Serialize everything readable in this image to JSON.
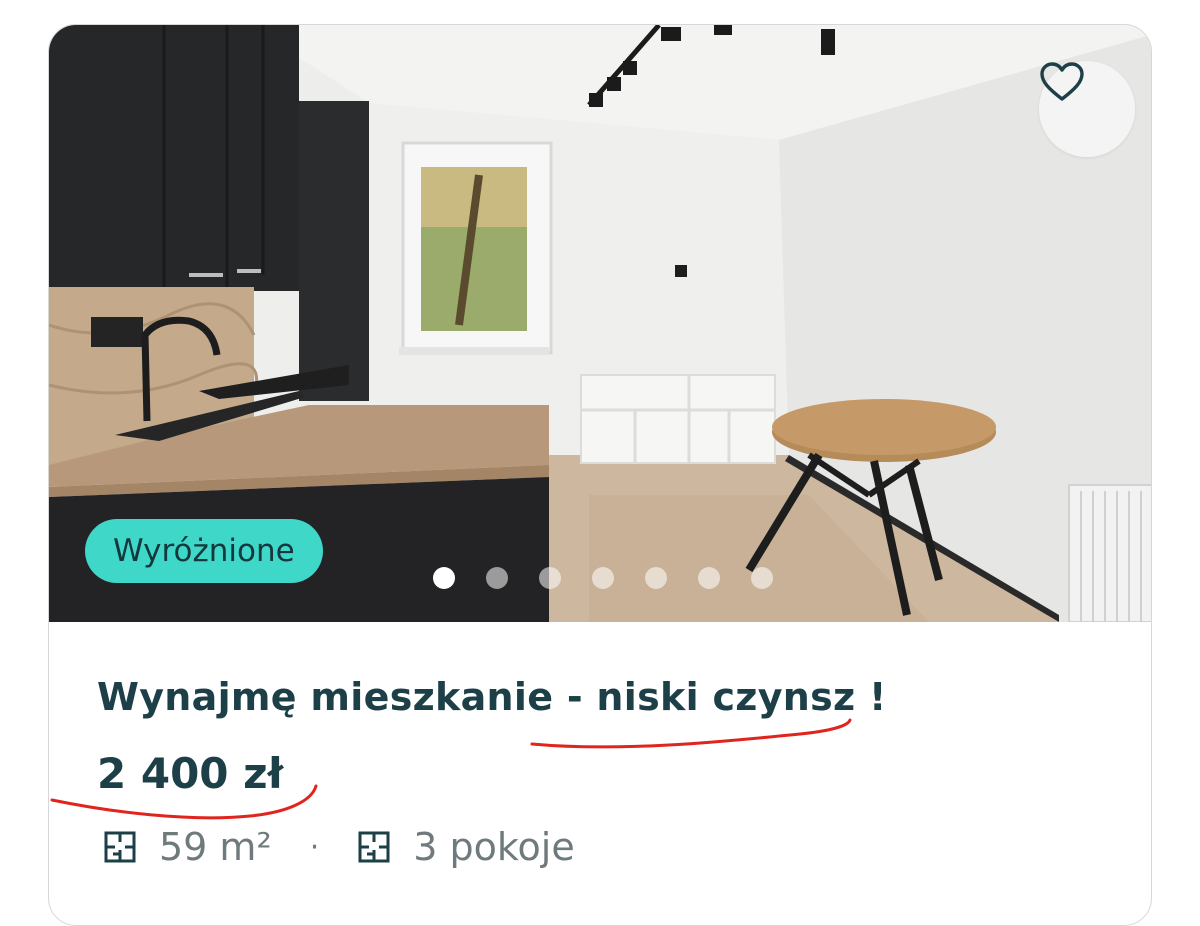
{
  "listing": {
    "badge": "Wyróżnione",
    "title": "Wynajmę mieszkanie - niski czynsz !",
    "price": "2 400 zł",
    "area": "59 m²",
    "separator": "·",
    "rooms": "3 pokoje"
  },
  "carousel": {
    "total": 7,
    "active": 1
  },
  "icons": {
    "favorite": "heart-outline-icon",
    "area": "floorplan-icon",
    "rooms": "floorplan-icon"
  },
  "colors": {
    "accent": "#3fd8c8",
    "text": "#1d3f47",
    "muted": "#6f7a7c",
    "annotation": "#e0251e"
  }
}
